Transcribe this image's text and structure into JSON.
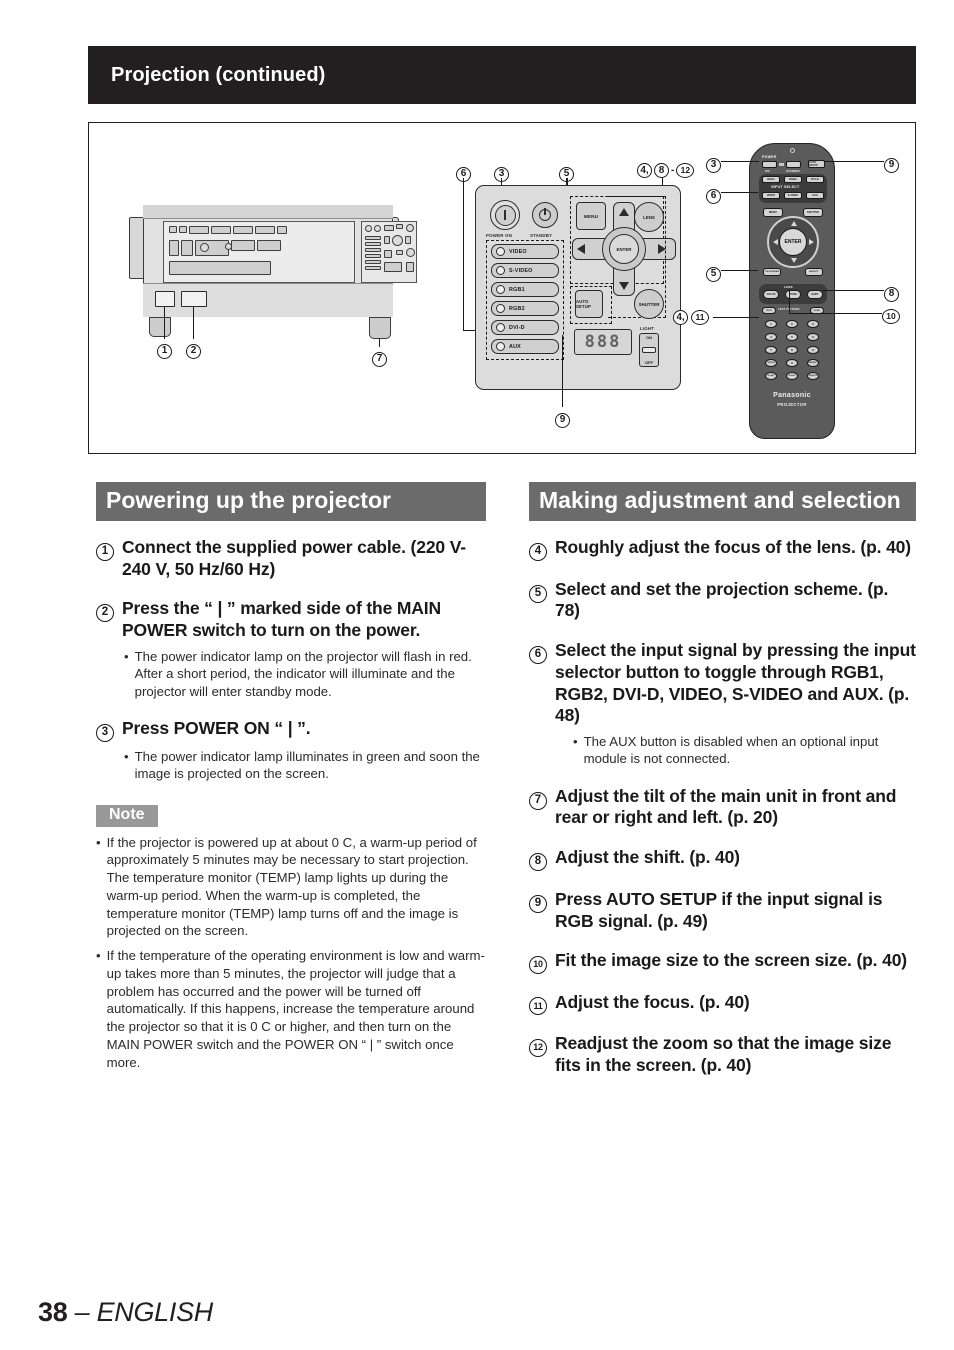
{
  "header": {
    "title": "Projection (continued)"
  },
  "figure": {
    "callouts_top": [
      "6",
      "3",
      "5",
      "4,",
      "8",
      "-",
      "12"
    ],
    "callout_bottom_center": "9",
    "projector": {
      "callouts": [
        "1",
        "2",
        "7"
      ],
      "control_panel": {
        "power_on_label": "POWER ON",
        "standby_label": "STANDBY",
        "menu_label": "MENU",
        "lens_label": "LENS",
        "enter_label": "ENTER",
        "auto_setup_label": "AUTO SETUP",
        "shutter_label": "SHUTTER",
        "light_label": "LIGHT",
        "light_on": "ON",
        "light_off": "OFF",
        "segment_display": "888",
        "input_buttons": [
          "VIDEO",
          "S-VIDEO",
          "RGB1",
          "RGB2",
          "DVI-D",
          "AUX"
        ]
      }
    },
    "remote": {
      "callouts_left": [
        "3",
        "6",
        "5",
        "4,",
        "11"
      ],
      "callouts_right": [
        "9",
        "8",
        "10"
      ],
      "power_label": "POWER",
      "power_on_label": "ON",
      "power_standby_label": "STANDBY",
      "auto_setup_label": "AUTO SETUP",
      "input_select_label": "INPUT SELECT",
      "input_row1": [
        "RGB1",
        "RGB2",
        "DVI-D"
      ],
      "input_row2": [
        "VIDEO",
        "S-VIDEO",
        "AUX"
      ],
      "menu_label": "MENU",
      "shutter_label": "SHUTTER",
      "enter_label": "ENTER",
      "on_screen_label": "ON SCREEN",
      "aspect_label": "ASPECT",
      "lens_label": "LENS",
      "focus_label": "FOCUS",
      "zoom_label": "ZOOM",
      "shift_label": "SHIFT",
      "test_label": "TEST",
      "test_pattern_label": "TEST PATTERN",
      "func_label": "FUNC",
      "keypad": [
        "1",
        "2",
        "3",
        "4",
        "5",
        "6",
        "7",
        "8",
        "9",
        "ENTER",
        "0",
        "DEFAULT"
      ],
      "bottom_keys": [
        "ID SET",
        "ID ALL",
        "STATUS"
      ],
      "brand": "Panasonic",
      "brand_sub": "PROJECTOR"
    }
  },
  "left_column": {
    "heading": "Powering up the projector",
    "steps": [
      {
        "num": "1",
        "text": "Connect the supplied power cable. (220 V-240 V, 50 Hz/60 Hz)",
        "bullets": []
      },
      {
        "num": "2",
        "text": "Press the “ | ” marked side of the MAIN POWER switch to turn on the power.",
        "bullets": [
          "The power indicator lamp on the projector will flash in red. After a short period, the indicator will illuminate and the projector will enter standby mode."
        ]
      },
      {
        "num": "3",
        "text": "Press POWER ON “ | ”.",
        "bullets": [
          "The power indicator lamp illuminates in green and soon the image is projected on the screen."
        ]
      }
    ],
    "note_label": "Note",
    "notes": [
      "If the projector is powered up at about 0  C, a warm-up period of approximately 5 minutes may be necessary to start projection. The temperature monitor (TEMP) lamp lights up during the warm-up period. When the warm-up is completed, the temperature monitor (TEMP) lamp turns off and the image is projected on the screen.",
      "If the temperature of the operating environment is low and warm-up takes more than 5 minutes, the projector will judge that a problem has occurred and the power will be turned off automatically. If this happens, increase the temperature around the projector so that it is 0  C or higher, and then turn on the MAIN POWER switch and the POWER ON “ | ” switch once more."
    ]
  },
  "right_column": {
    "heading": "Making adjustment and selection",
    "steps": [
      {
        "num": "4",
        "text": "Roughly adjust the focus of the lens. (p. 40)",
        "bullets": []
      },
      {
        "num": "5",
        "text": "Select and set the projection scheme. (p. 78)",
        "bullets": []
      },
      {
        "num": "6",
        "text": "Select the input signal by pressing the input selector button to toggle through RGB1, RGB2, DVI-D, VIDEO, S-VIDEO and AUX. (p. 48)",
        "bullets": [
          "The AUX button is disabled when an optional input module is not connected."
        ]
      },
      {
        "num": "7",
        "text": "Adjust the tilt of the main unit in front and rear or right and left. (p. 20)",
        "bullets": []
      },
      {
        "num": "8",
        "text": "Adjust the shift. (p. 40)",
        "bullets": []
      },
      {
        "num": "9",
        "text": "Press AUTO SETUP  if the input signal is RGB signal. (p. 49)",
        "bullets": []
      },
      {
        "num": "10",
        "text": "Fit the image size to the screen size. (p. 40)",
        "bullets": []
      },
      {
        "num": "11",
        "text": "Adjust the focus. (p. 40)",
        "bullets": []
      },
      {
        "num": "12",
        "text": "Readjust the zoom so that the image size fits in the screen. (p. 40)",
        "bullets": []
      }
    ]
  },
  "footer": {
    "page_number": "38",
    "separator": " – ",
    "language": "ENGLISH"
  },
  "colors": {
    "title_bar": "#231f20",
    "section_heading": "#6b6b6b",
    "note_badge": "#999999",
    "text": "#1a1a1a"
  }
}
